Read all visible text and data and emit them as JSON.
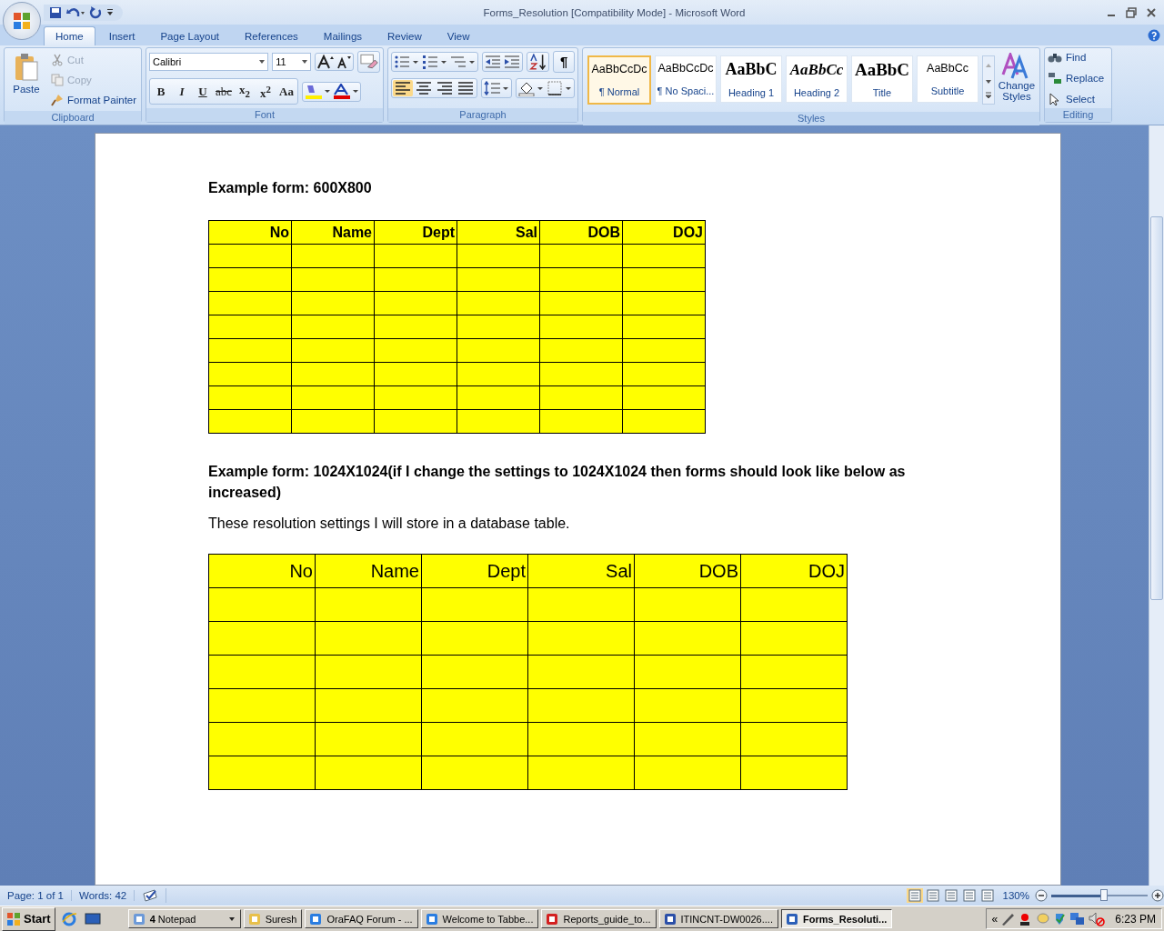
{
  "window": {
    "title": "Forms_Resolution [Compatibility Mode] - Microsoft Word"
  },
  "tabs": [
    {
      "label": "Home",
      "selected": true
    },
    {
      "label": "Insert",
      "selected": false
    },
    {
      "label": "Page Layout",
      "selected": false
    },
    {
      "label": "References",
      "selected": false
    },
    {
      "label": "Mailings",
      "selected": false
    },
    {
      "label": "Review",
      "selected": false
    },
    {
      "label": "View",
      "selected": false
    }
  ],
  "ribbon": {
    "clipboard": {
      "label": "Clipboard",
      "paste": "Paste",
      "actions": [
        {
          "label": "Cut",
          "kind": "cut",
          "disabled": true
        },
        {
          "label": "Copy",
          "kind": "copy",
          "disabled": true
        },
        {
          "label": "Format Painter",
          "kind": "painter",
          "disabled": false
        }
      ]
    },
    "font": {
      "label": "Font",
      "family": "Calibri",
      "size": "11",
      "format_buttons": [
        {
          "label": "B",
          "kind": "bold"
        },
        {
          "label": "I",
          "kind": "italic"
        },
        {
          "label": "U",
          "kind": "underline"
        },
        {
          "label": "abc",
          "kind": "strike"
        },
        {
          "label": "x$_{2}$",
          "kind": "plain"
        },
        {
          "label": "x$^{2}$",
          "kind": "plain"
        },
        {
          "label": "Aa",
          "kind": "plain"
        }
      ]
    },
    "paragraph": {
      "label": "Paragraph",
      "show_marks": "¶",
      "alignments": [
        {
          "selected": true
        },
        {
          "selected": false
        },
        {
          "selected": false
        },
        {
          "selected": false
        }
      ]
    },
    "styles": {
      "label": "Styles",
      "items": [
        {
          "sample": "AaBbCcDc",
          "name": "¶ Normal",
          "kind": "normal",
          "selected": true
        },
        {
          "sample": "AaBbCcDc",
          "name": "¶ No Spaci...",
          "kind": "normal",
          "selected": false
        },
        {
          "sample": "AaBbC",
          "name": "Heading 1",
          "kind": "heading1",
          "selected": false
        },
        {
          "sample": "AaBbCc",
          "name": "Heading 2",
          "kind": "heading2",
          "selected": false
        },
        {
          "sample": "AaBbC",
          "name": "Title",
          "kind": "title",
          "selected": false
        },
        {
          "sample": "AaBbCc",
          "name": "Subtitle",
          "kind": "normal",
          "selected": false
        }
      ],
      "change_styles": "Change Styles"
    },
    "editing": {
      "label": "Editing",
      "actions": [
        {
          "label": "Find",
          "kind": "find"
        },
        {
          "label": "Replace",
          "kind": "replace"
        },
        {
          "label": "Select",
          "kind": "select"
        }
      ]
    }
  },
  "document": {
    "blocks": [
      {
        "kind": "heading",
        "text": "Example form: 600X800"
      },
      {
        "kind": "small_table",
        "columns": [
          "No",
          "Name",
          "Dept",
          "Sal",
          "DOB",
          "DOJ"
        ],
        "rows": [
          {
            "kind": "empty"
          },
          {
            "kind": "empty"
          },
          {
            "kind": "empty"
          },
          {
            "kind": "empty"
          },
          {
            "kind": "empty"
          },
          {
            "kind": "empty"
          },
          {
            "kind": "empty"
          },
          {
            "kind": "empty"
          }
        ]
      },
      {
        "kind": "heading",
        "text": "Example form: 1024X1024(if I change the settings to 1024X1024 then forms should look like below as increased)"
      },
      {
        "kind": "paragraph",
        "text": "These resolution settings I will store in a database table."
      },
      {
        "kind": "large_table",
        "columns": [
          "No",
          "Name",
          "Dept",
          "Sal",
          "DOB",
          "DOJ"
        ],
        "rows": [
          {
            "kind": "empty"
          },
          {
            "kind": "empty"
          },
          {
            "kind": "empty"
          },
          {
            "kind": "empty"
          },
          {
            "kind": "empty"
          },
          {
            "kind": "empty"
          }
        ]
      }
    ]
  },
  "status_bar": {
    "page": "Page: 1 of 1",
    "words": "Words: 42",
    "zoom": "130%",
    "zoom_slider": {
      "level": 0.55
    },
    "views": [
      {
        "selected": true
      },
      {
        "selected": false
      },
      {
        "selected": false
      },
      {
        "selected": false
      },
      {
        "selected": false
      }
    ]
  },
  "taskbar": {
    "start": "Start",
    "tasks": [
      {
        "label": "**4** Notepad",
        "kind": "notepad",
        "selected": false
      },
      {
        "label": "Suresh",
        "kind": "folder",
        "selected": false
      },
      {
        "label": "OraFAQ Forum - ...",
        "kind": "browser",
        "selected": false
      },
      {
        "label": "Welcome to Tabbe...",
        "kind": "browser",
        "selected": false
      },
      {
        "label": "Reports_guide_to...",
        "kind": "pdf",
        "selected": false
      },
      {
        "label": "ITINCNT-DW0026....",
        "kind": "remote",
        "selected": false
      },
      {
        "label": "Forms_Resoluti...",
        "kind": "word",
        "selected": true
      }
    ],
    "tray_toggle": "«",
    "clock": "6:23 PM"
  }
}
